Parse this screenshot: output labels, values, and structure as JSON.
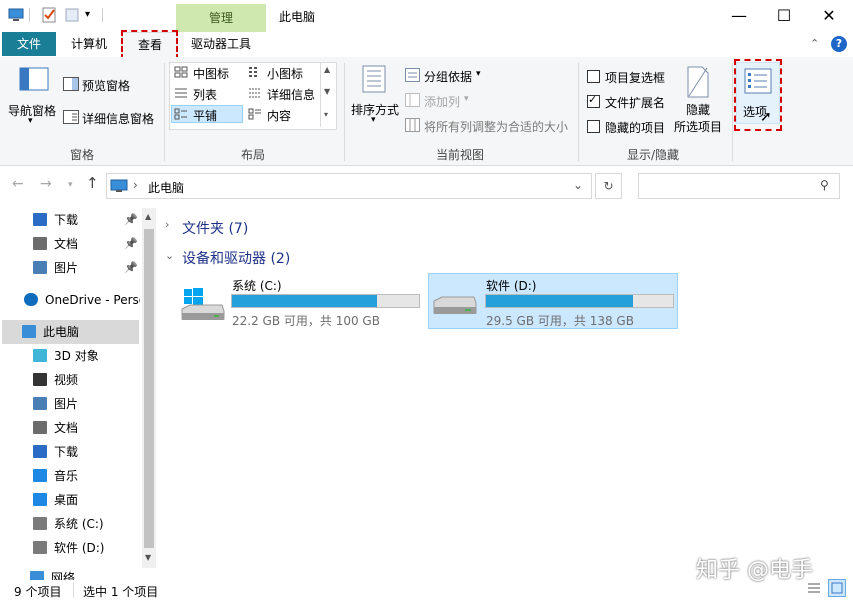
{
  "title_bar": {
    "context_tab": "管理",
    "window_title": "此电脑",
    "minimize_icon": "minimize-icon",
    "maximize_icon": "maximize-icon",
    "close_icon": "close-icon"
  },
  "menu": {
    "file": "文件",
    "computer": "计算机",
    "view": "查看",
    "drive_tools": "驱动器工具"
  },
  "ribbon": {
    "panes": {
      "label": "窗格",
      "nav_pane": "导航窗格",
      "preview_pane": "预览窗格",
      "details_pane": "详细信息窗格"
    },
    "layout": {
      "label": "布局",
      "medium_icons": "中图标",
      "small_icons": "小图标",
      "list": "列表",
      "details": "详细信息",
      "tiles": "平铺",
      "content": "内容"
    },
    "current_view": {
      "label": "当前视图",
      "sort_by": "排序方式",
      "group_by": "分组依据",
      "add_columns": "添加列",
      "size_all_columns": "将所有列调整为合适的大小"
    },
    "show_hide": {
      "label": "显示/隐藏",
      "item_checkboxes": "项目复选框",
      "item_checkboxes_checked": false,
      "file_extensions": "文件扩展名",
      "file_extensions_checked": true,
      "hidden_items": "隐藏的项目",
      "hidden_items_checked": false,
      "hide_selected_line1": "隐藏",
      "hide_selected_line2": "所选项目"
    },
    "options": "选项"
  },
  "address": {
    "location": "此电脑",
    "search_placeholder": ""
  },
  "nav_pane": [
    {
      "label": "下载",
      "icon": "download-icon",
      "pinned": true
    },
    {
      "label": "文档",
      "icon": "document-icon",
      "pinned": true
    },
    {
      "label": "图片",
      "icon": "pictures-icon",
      "pinned": true
    },
    {
      "label": "OneDrive - Perso",
      "icon": "onedrive-icon"
    },
    {
      "label": "此电脑",
      "icon": "this-pc-icon",
      "selected": true
    },
    {
      "label": "3D 对象",
      "icon": "3d-objects-icon"
    },
    {
      "label": "视频",
      "icon": "video-icon"
    },
    {
      "label": "图片",
      "icon": "pictures-icon"
    },
    {
      "label": "文档",
      "icon": "document-icon"
    },
    {
      "label": "下载",
      "icon": "download-icon"
    },
    {
      "label": "音乐",
      "icon": "music-icon"
    },
    {
      "label": "桌面",
      "icon": "desktop-icon"
    },
    {
      "label": "系统 (C:)",
      "icon": "drive-c-icon"
    },
    {
      "label": "软件 (D:)",
      "icon": "drive-d-icon"
    },
    {
      "label": "网络",
      "icon": "network-icon"
    }
  ],
  "content": {
    "folders_header": "文件夹 (7)",
    "devices_header": "设备和驱动器 (2)",
    "drives": [
      {
        "name": "系统 (C:)",
        "info": "22.2 GB 可用，共 100 GB",
        "used_fraction": 0.778,
        "selected": false
      },
      {
        "name": "软件 (D:)",
        "info": "29.5 GB 可用，共 138 GB",
        "used_fraction": 0.786,
        "selected": true
      }
    ]
  },
  "status": {
    "item_count": "9 个项目",
    "selected_count": "选中 1 个项目"
  },
  "watermark": "知乎 @电手",
  "colors": {
    "accent": "#1a7f96",
    "manage_tab": "#cfe8b0",
    "progress": "#26a0da",
    "selection": "#cce8ff",
    "highlight_dash": "#d40000"
  }
}
